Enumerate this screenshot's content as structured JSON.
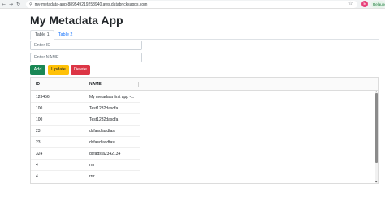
{
  "browser": {
    "url": "my-metadata-app-889549219258940.aws.databricksapps.com",
    "profile_initial": "E",
    "relaunch_label": "Relaunc"
  },
  "app": {
    "title": "My Metadata App",
    "tabs": [
      {
        "label": "Table 1",
        "active": true
      },
      {
        "label": "Table 2",
        "active": false
      }
    ],
    "id_placeholder": "Enter ID",
    "name_placeholder": "Enter NAME",
    "buttons": {
      "add": "Add",
      "update": "Update",
      "delete": "Delete"
    },
    "colors": {
      "add": "#198754",
      "update": "#ffc107",
      "delete": "#dc3545",
      "tab_link": "#0d6efd"
    }
  },
  "table": {
    "columns": [
      "ID",
      "NAME"
    ],
    "rows": [
      {
        "id": "123456",
        "name": "My metadata first app -..."
      },
      {
        "id": "100",
        "name": "Test1232dasdfa"
      },
      {
        "id": "100",
        "name": "Test1232dasdfa"
      },
      {
        "id": "23",
        "name": "dsfasdfasdfas"
      },
      {
        "id": "23",
        "name": "dsfasdfasdfas"
      },
      {
        "id": "324",
        "name": "dsfadsfa2342134"
      },
      {
        "id": "4",
        "name": "rrrr"
      },
      {
        "id": "4",
        "name": "rrrr"
      }
    ]
  }
}
